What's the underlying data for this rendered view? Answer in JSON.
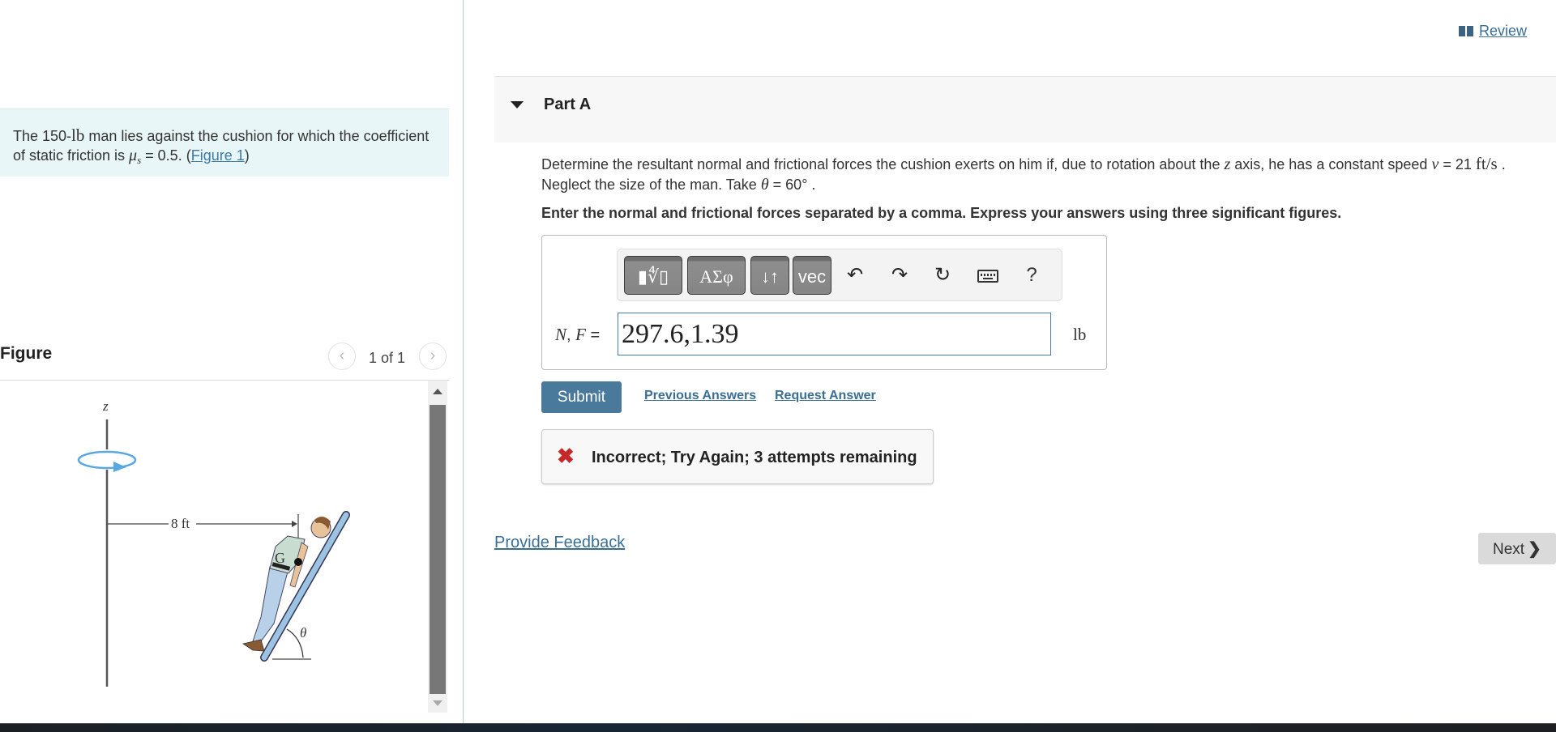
{
  "problem": {
    "text_prefix": "The 150-",
    "weight_unit": "lb",
    "text_mid": " man lies against the cushion for which the coefficient of static friction is ",
    "mu_symbol": "μ",
    "mu_sub": "s",
    "text_after_mu": " = 0.5. (",
    "figure_link": "Figure 1",
    "text_end": ")"
  },
  "figure": {
    "title": "Figure",
    "count": "1 of 1",
    "prev_icon": "chevron-left-icon",
    "next_icon": "chevron-right-icon",
    "labels": {
      "axis": "z",
      "distance": "8 ft",
      "point": "G",
      "angle": "θ"
    },
    "colors": {
      "rotation_arrow": "#5aa8e0",
      "cushion": "#9dc3e2",
      "pants": "#b8d0e8"
    }
  },
  "header": {
    "review_label": " Review",
    "review_icon": "book-icon"
  },
  "part": {
    "title": "Part A",
    "question_1": "Determine the resultant normal and frictional forces the cushion exerts on him if, due to rotation about the ",
    "z_var": "z",
    "question_2": " axis, he has a constant speed ",
    "v_var": "v",
    "question_3": " = 21 ",
    "speed_unit": "ft/s",
    "question_4": " .",
    "question_line2_a": "Neglect the size of the man. Take ",
    "theta_var": "θ",
    "question_line2_b": " = 60° .",
    "instructions": "Enter the normal and frictional forces separated by a comma. Express your answers using three significant figures."
  },
  "toolbar": {
    "templates_label": "▮∜▯",
    "greek_label": "ΑΣφ",
    "arrows_label": "↓↑",
    "vec_label": "vec",
    "undo_glyph": "↶",
    "redo_glyph": "↷",
    "reset_glyph": "↻",
    "help_label": "?"
  },
  "answer": {
    "label_n": "N",
    "label_sep": ", ",
    "label_f": "F",
    "label_eq": " =",
    "value": "297.6,1.39",
    "unit": "lb"
  },
  "actions": {
    "submit": "Submit",
    "previous_answers": "Previous Answers",
    "request_answer": "Request Answer"
  },
  "feedback": {
    "icon": "✖",
    "message": "Incorrect; Try Again; 3 attempts remaining",
    "icon_color": "#c62828"
  },
  "footer": {
    "provide_feedback": "Provide Feedback",
    "next_label": "Next",
    "next_glyph": "❯"
  }
}
